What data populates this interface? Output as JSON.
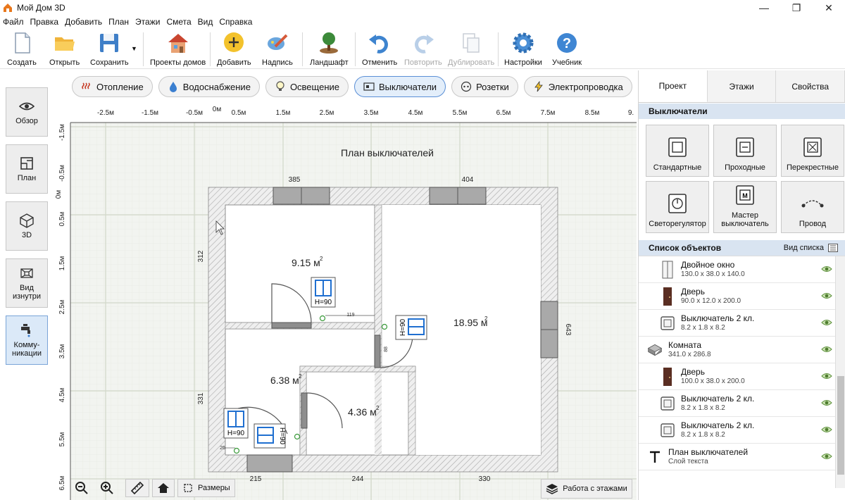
{
  "window": {
    "title": "Мой Дом 3D"
  },
  "menu": [
    "Файл",
    "Правка",
    "Добавить",
    "План",
    "Этажи",
    "Смета",
    "Вид",
    "Справка"
  ],
  "toolbar": {
    "create": "Создать",
    "open": "Открыть",
    "save": "Сохранить",
    "projects": "Проекты домов",
    "add": "Добавить",
    "label": "Надпись",
    "landscape": "Ландшафт",
    "undo": "Отменить",
    "redo": "Повторить",
    "duplicate": "Дублировать",
    "settings": "Настройки",
    "tutorial": "Учебник"
  },
  "categories": [
    "Отопление",
    "Водоснабжение",
    "Освещение",
    "Выключатели",
    "Розетки",
    "Электропроводка"
  ],
  "active_category": "Выключатели",
  "leftnav": [
    "Обзор",
    "План",
    "3D",
    "Вид изнутри",
    "Комму-никации"
  ],
  "plan": {
    "title": "План выключателей",
    "ruler_x": [
      "-2.5м",
      "-1.5м",
      "-0.5м",
      "0м",
      "0.5м",
      "1.5м",
      "2.5м",
      "3.5м",
      "4.5м",
      "5.5м",
      "6.5м",
      "7.5м",
      "8.5м",
      "9."
    ],
    "ruler_y": [
      "-1.5м",
      "-0.5м",
      "0м",
      "0.5м",
      "1.5м",
      "2.5м",
      "3.5м",
      "4.5м",
      "5.5м",
      "6.5м"
    ],
    "dims": {
      "top_left": "385",
      "top_right": "404",
      "left_top": "312",
      "left_bottom": "331",
      "right": "643",
      "bottom_1": "215",
      "bottom_2": "244",
      "bottom_3": "330",
      "door_w": "119",
      "small_1": "26",
      "small_2": "88"
    },
    "rooms": [
      {
        "area": "9.15 м",
        "sup": "2"
      },
      {
        "area": "18.95 м",
        "sup": "2"
      },
      {
        "area": "6.38 м",
        "sup": "2"
      },
      {
        "area": "4.36 м",
        "sup": "2"
      }
    ],
    "switch_label": "H=90"
  },
  "bottom_tools": {
    "dimensions": "Размеры",
    "floors": "Работа с этажами"
  },
  "right_panel": {
    "tabs": [
      "Проект",
      "Этажи",
      "Свойства"
    ],
    "section_title": "Выключатели",
    "tiles": [
      "Стандартные",
      "Проходные",
      "Перекрестные",
      "Светорегулятор",
      "Мастер выключатель",
      "Провод"
    ],
    "objlist_title": "Список объектов",
    "view_list": "Вид списка",
    "objects": [
      {
        "name": "Двойное окно",
        "size": "130.0 x 38.0 x 140.0",
        "icon": "window-icon",
        "indent": true
      },
      {
        "name": "Дверь",
        "size": "90.0 x 12.0 x 200.0",
        "icon": "door-icon",
        "indent": true
      },
      {
        "name": "Выключатель 2 кл.",
        "size": "8.2 x 1.8 x 8.2",
        "icon": "switch-icon",
        "indent": true
      },
      {
        "name": "Комната",
        "size": "341.0 x 286.8",
        "icon": "room-icon",
        "indent": false
      },
      {
        "name": "Дверь",
        "size": "100.0 x 38.0 x 200.0",
        "icon": "door-icon",
        "indent": true
      },
      {
        "name": "Выключатель 2 кл.",
        "size": "8.2 x 1.8 x 8.2",
        "icon": "switch-icon",
        "indent": true
      },
      {
        "name": "Выключатель 2 кл.",
        "size": "8.2 x 1.8 x 8.2",
        "icon": "switch-icon",
        "indent": true
      },
      {
        "name": "План выключателей",
        "size": "Слой текста",
        "icon": "text-icon",
        "indent": false
      }
    ]
  }
}
